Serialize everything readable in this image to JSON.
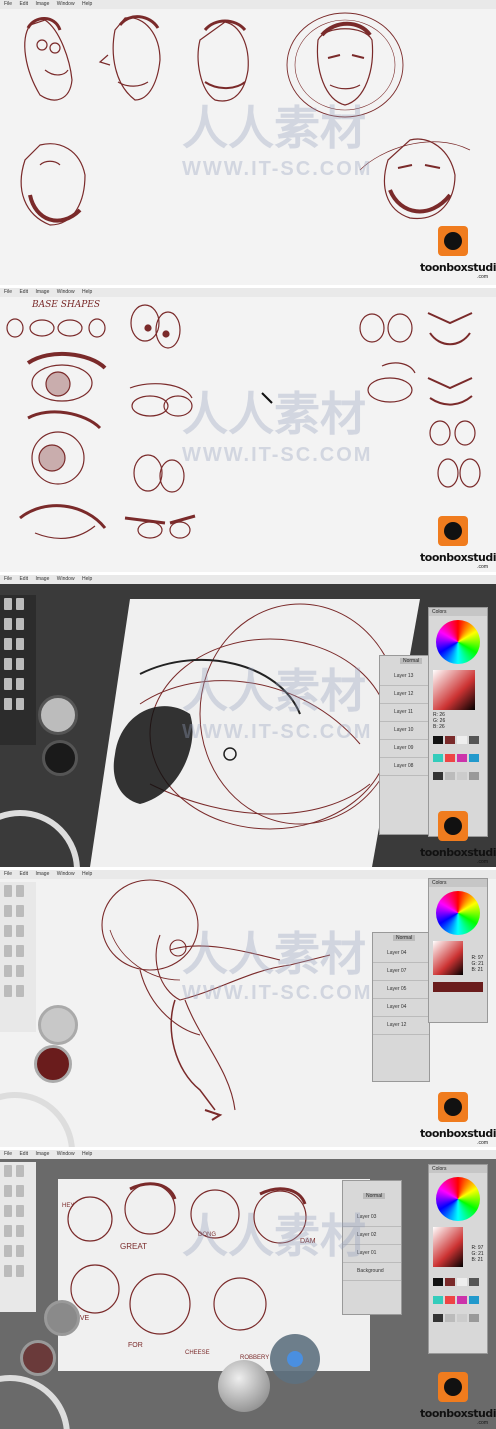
{
  "menu": [
    "File",
    "Edit",
    "Image",
    "Window",
    "Help"
  ],
  "watermark": {
    "cn": "人人素材",
    "url": "WWW.IT-SC.COM"
  },
  "logo": {
    "text": "toonboxstudio",
    "suffix": ".com"
  },
  "frame2": {
    "heading": "BASE SHAPES"
  },
  "frame3": {
    "colors_title": "Colors",
    "blend_mode": "Normal",
    "layers": [
      "Layer 13",
      "Layer 12",
      "Layer 11",
      "Layer 10",
      "Layer 09",
      "Layer 08"
    ],
    "rgb": [
      {
        "k": "R:",
        "v": "26"
      },
      {
        "k": "G:",
        "v": "26"
      },
      {
        "k": "B:",
        "v": "26"
      }
    ]
  },
  "frame4": {
    "colors_title": "Colors",
    "blend_mode": "Normal",
    "layers": [
      "Layer 04",
      "Layer 07",
      "Layer 05",
      "Layer 04",
      "Layer 12"
    ],
    "rgb": [
      {
        "k": "R:",
        "v": "97"
      },
      {
        "k": "G:",
        "v": "21"
      },
      {
        "k": "B:",
        "v": "21"
      }
    ]
  },
  "frame5": {
    "colors_title": "Colors",
    "blend_mode": "Normal",
    "layers": [
      "Layer 03",
      "Layer 02",
      "Layer 01",
      "Background"
    ],
    "rgb": [
      {
        "k": "R:",
        "v": "97"
      },
      {
        "k": "G:",
        "v": "21"
      },
      {
        "k": "B:",
        "v": "21"
      }
    ],
    "sketch_labels": [
      "HEY",
      "GREAT",
      "DONG",
      "DAM",
      "LIVE",
      "FOR",
      "CHEESE",
      "ROBBERY"
    ]
  },
  "colors": {
    "sketch": "#7a2a2a",
    "accent": "#f07c1e",
    "panel": "#d8d8d8"
  }
}
